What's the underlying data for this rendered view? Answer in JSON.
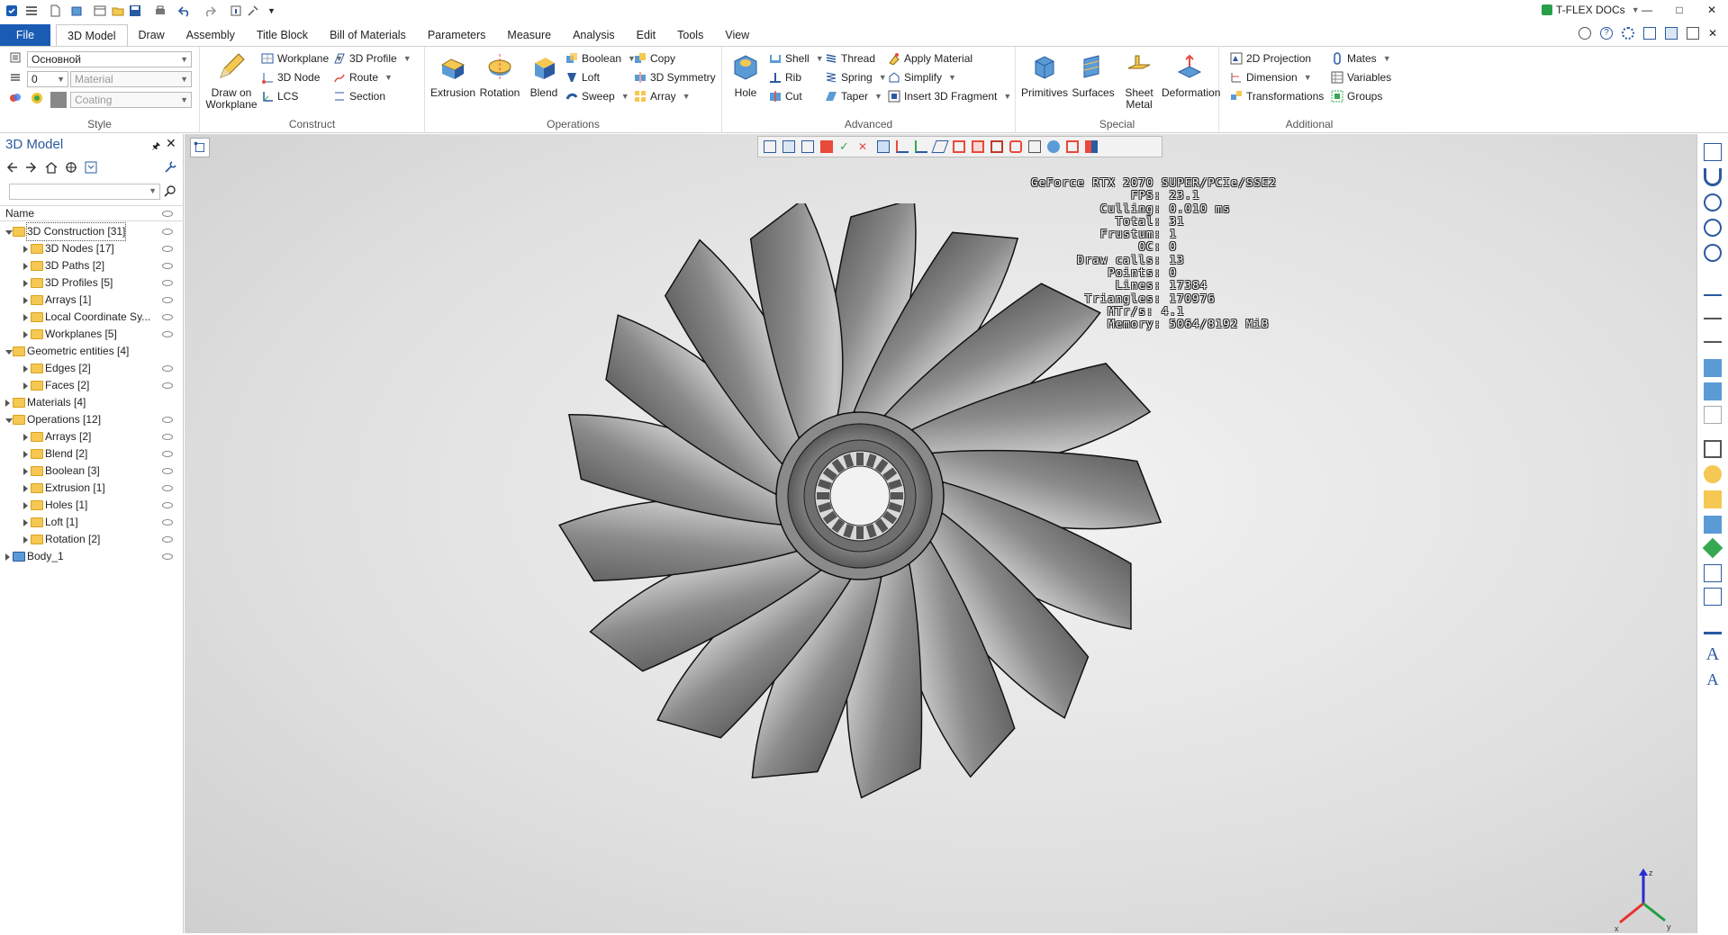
{
  "app": {
    "brand": "T-FLEX DOCs"
  },
  "tabs": [
    {
      "label": "File"
    },
    {
      "label": "3D Model"
    },
    {
      "label": "Draw"
    },
    {
      "label": "Assembly"
    },
    {
      "label": "Title Block"
    },
    {
      "label": "Bill of Materials"
    },
    {
      "label": "Parameters"
    },
    {
      "label": "Measure"
    },
    {
      "label": "Analysis"
    },
    {
      "label": "Edit"
    },
    {
      "label": "Tools"
    },
    {
      "label": "View"
    }
  ],
  "ribbon": {
    "style": {
      "label": "Style",
      "layer_value": "Основной",
      "number_value": "0",
      "material_placeholder": "Material",
      "coating_placeholder": "Coating"
    },
    "construct": {
      "label": "Construct",
      "draw_on_workplane_1": "Draw on",
      "draw_on_workplane_2": "Workplane",
      "workplane": "Workplane",
      "node_3d": "3D Node",
      "lcs": "LCS",
      "profile_3d": "3D Profile",
      "route": "Route",
      "section": "Section"
    },
    "operations": {
      "label": "Operations",
      "extrusion": "Extrusion",
      "rotation": "Rotation",
      "blend": "Blend",
      "boolean": "Boolean",
      "loft": "Loft",
      "sweep": "Sweep",
      "copy": "Copy",
      "symmetry_3d": "3D Symmetry",
      "array": "Array"
    },
    "advanced": {
      "label": "Advanced",
      "hole": "Hole",
      "shell": "Shell",
      "rib": "Rib",
      "cut": "Cut",
      "thread": "Thread",
      "spring": "Spring",
      "taper": "Taper",
      "apply_material": "Apply Material",
      "simplify": "Simplify",
      "insert_fragment": "Insert 3D Fragment"
    },
    "special": {
      "label": "Special",
      "primitives": "Primitives",
      "surfaces": "Surfaces",
      "sheet_metal_1": "Sheet",
      "sheet_metal_2": "Metal",
      "deformation": "Deformation"
    },
    "additional": {
      "label": "Additional",
      "projection_2d": "2D Projection",
      "dimension": "Dimension",
      "transformations": "Transformations",
      "mates": "Mates",
      "variables": "Variables",
      "groups": "Groups"
    }
  },
  "left_panel": {
    "title": "3D Model",
    "column_header": "Name",
    "tree": [
      {
        "label": "3D Construction [31]",
        "level": 0,
        "open": true,
        "eye": true,
        "selected": true,
        "icon": "folder"
      },
      {
        "label": "3D Nodes [17]",
        "level": 1,
        "open": false,
        "eye": true,
        "icon": "folder"
      },
      {
        "label": "3D Paths [2]",
        "level": 1,
        "open": false,
        "eye": true,
        "icon": "folder"
      },
      {
        "label": "3D Profiles [5]",
        "level": 1,
        "open": false,
        "eye": true,
        "icon": "folder"
      },
      {
        "label": "Arrays [1]",
        "level": 1,
        "open": false,
        "eye": true,
        "icon": "folder"
      },
      {
        "label": "Local Coordinate Sy...",
        "level": 1,
        "open": false,
        "eye": true,
        "icon": "folder"
      },
      {
        "label": "Workplanes [5]",
        "level": 1,
        "open": false,
        "eye": true,
        "icon": "folder"
      },
      {
        "label": "Geometric entities [4]",
        "level": 0,
        "open": true,
        "eye": false,
        "icon": "folder"
      },
      {
        "label": "Edges [2]",
        "level": 1,
        "open": false,
        "eye": true,
        "icon": "folder"
      },
      {
        "label": "Faces [2]",
        "level": 1,
        "open": false,
        "eye": true,
        "icon": "folder"
      },
      {
        "label": "Materials [4]",
        "level": 0,
        "open": false,
        "eye": false,
        "icon": "folder"
      },
      {
        "label": "Operations [12]",
        "level": 0,
        "open": true,
        "eye": true,
        "icon": "folder"
      },
      {
        "label": "Arrays [2]",
        "level": 1,
        "open": false,
        "eye": true,
        "icon": "folder"
      },
      {
        "label": "Blend [2]",
        "level": 1,
        "open": false,
        "eye": true,
        "icon": "folder"
      },
      {
        "label": "Boolean [3]",
        "level": 1,
        "open": false,
        "eye": true,
        "icon": "folder"
      },
      {
        "label": "Extrusion [1]",
        "level": 1,
        "open": false,
        "eye": true,
        "icon": "folder"
      },
      {
        "label": "Holes [1]",
        "level": 1,
        "open": false,
        "eye": true,
        "icon": "folder"
      },
      {
        "label": "Loft [1]",
        "level": 1,
        "open": false,
        "eye": true,
        "icon": "folder"
      },
      {
        "label": "Rotation [2]",
        "level": 1,
        "open": false,
        "eye": true,
        "icon": "folder"
      },
      {
        "label": "Body_1",
        "level": 0,
        "open": false,
        "eye": true,
        "icon": "body"
      }
    ]
  },
  "stats": {
    "text": "GeForce RTX 2070 SUPER/PCIe/SSE2\n             FPS: 23.1\n         Culling: 0.010 ms\n           Total: 31\n         Frustum: 1\n              OC: 0\n      Draw calls: 13\n          Points: 0\n           Lines: 17384\n       Triangles: 170976\n          MTr/s: 4.1\n          Memory: 5064/8192 MiB"
  },
  "triad": {
    "x": "x",
    "y": "y",
    "z": "z"
  },
  "colors": {
    "file_tab": "#1a5bb4",
    "title_blue": "#2a5aa0",
    "folder": "#f5c753"
  }
}
